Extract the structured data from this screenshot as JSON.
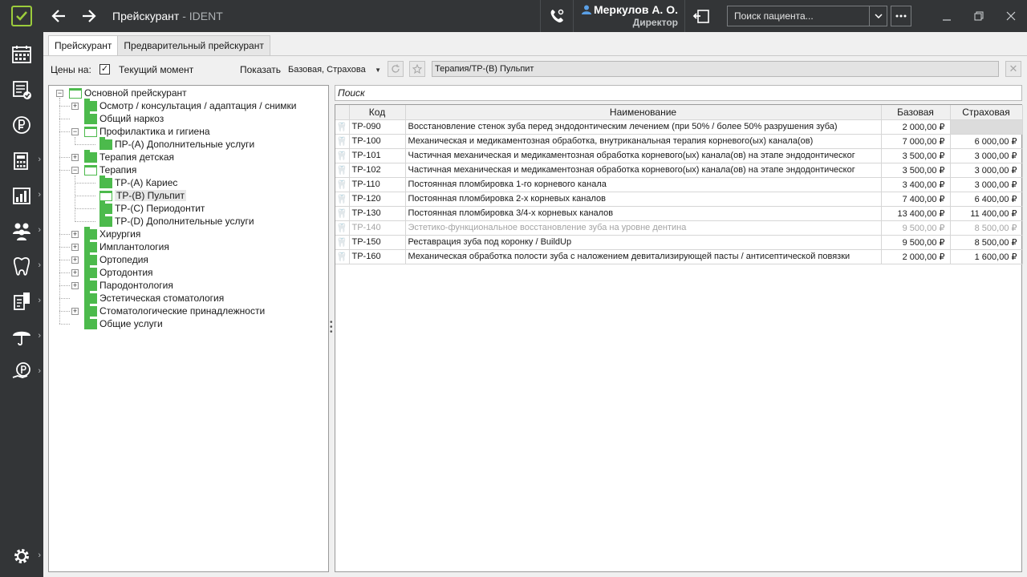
{
  "window": {
    "title": "Прейскурант",
    "app_suffix": "- IDENT"
  },
  "user": {
    "name": "Меркулов А. О.",
    "role": "Директор"
  },
  "search_patient": {
    "placeholder": "Поиск пациента..."
  },
  "icons": {
    "logo": "check-logo-icon",
    "back": "arrow-left-icon",
    "forward": "arrow-right-icon",
    "phone": "phone-settings-icon",
    "user": "user-icon",
    "history": "back-history-icon",
    "more": "ellipsis-icon"
  },
  "sidebar": {
    "items": [
      {
        "icon": "schedule-grid-icon",
        "has_submenu": false
      },
      {
        "icon": "visits-list-icon",
        "has_submenu": false
      },
      {
        "icon": "ruble-icon",
        "has_submenu": false
      },
      {
        "icon": "calculator-icon",
        "has_submenu": true
      },
      {
        "icon": "reports-icon",
        "has_submenu": true
      },
      {
        "icon": "patients-icon",
        "has_submenu": true
      },
      {
        "icon": "tooth-icon",
        "has_submenu": true
      },
      {
        "icon": "documents-icon",
        "has_submenu": true
      },
      {
        "icon": "umbrella-icon",
        "has_submenu": true
      },
      {
        "icon": "ruble-hand-icon",
        "has_submenu": true
      }
    ],
    "settings_icon": "gear-icon"
  },
  "tabs": [
    {
      "label": "Прейскурант",
      "active": true
    },
    {
      "label": "Предварительный прейскурант",
      "active": false
    }
  ],
  "toolbar": {
    "prices_on_label": "Цены на:",
    "current_moment_label": "Текущий момент",
    "current_moment_checked": true,
    "show_label": "Показать",
    "show_value": "Базовая, Страхова",
    "path": "Терапия/ТР-(B) Пульпит",
    "clear_symbol": "✕"
  },
  "tree": {
    "root": "Основной прейскурант",
    "nodes": [
      {
        "label": "Осмотр / консультация / адаптация / снимки",
        "level": 1,
        "expand": "plus",
        "folder": "closed"
      },
      {
        "label": "Общий наркоз",
        "level": 1,
        "expand": "none",
        "folder": "closed"
      },
      {
        "label": "Профилактика и гигиена",
        "level": 1,
        "expand": "minus",
        "folder": "open"
      },
      {
        "label": "ПР-(A) Дополнительные услуги",
        "level": 2,
        "expand": "none",
        "folder": "closed"
      },
      {
        "label": "Терапия детская",
        "level": 1,
        "expand": "plus",
        "folder": "closed"
      },
      {
        "label": "Терапия",
        "level": 1,
        "expand": "minus",
        "folder": "open"
      },
      {
        "label": "ТР-(A) Кариес",
        "level": 2,
        "expand": "none",
        "folder": "closed"
      },
      {
        "label": "ТР-(B) Пульпит",
        "level": 2,
        "expand": "none",
        "folder": "open",
        "selected": true
      },
      {
        "label": "ТР-(C) Периодонтит",
        "level": 2,
        "expand": "none",
        "folder": "closed"
      },
      {
        "label": "ТР-(D) Дополнительные услуги",
        "level": 2,
        "expand": "none",
        "folder": "closed"
      },
      {
        "label": "Хирургия",
        "level": 1,
        "expand": "plus",
        "folder": "closed"
      },
      {
        "label": "Имплантология",
        "level": 1,
        "expand": "plus",
        "folder": "closed"
      },
      {
        "label": "Ортопедия",
        "level": 1,
        "expand": "plus",
        "folder": "closed"
      },
      {
        "label": "Ортодонтия",
        "level": 1,
        "expand": "plus",
        "folder": "closed"
      },
      {
        "label": "Пародонтология",
        "level": 1,
        "expand": "plus",
        "folder": "closed"
      },
      {
        "label": "Эстетическая стоматология",
        "level": 1,
        "expand": "none",
        "folder": "closed"
      },
      {
        "label": "Стоматологические принадлежности",
        "level": 1,
        "expand": "plus",
        "folder": "closed"
      },
      {
        "label": "Общие услуги",
        "level": 1,
        "expand": "none",
        "folder": "closed"
      }
    ]
  },
  "grid": {
    "search_placeholder": "Поиск",
    "columns": [
      "Код",
      "Наименование",
      "Базовая",
      "Страховая"
    ],
    "rows": [
      {
        "code": "ТР-090",
        "name": "Восстановление стенок зуба перед эндодонтическим лечением (при 50% / более 50% разрушения зуба)",
        "base": "2 000,00 ₽",
        "insurance": "",
        "disabled": false
      },
      {
        "code": "ТР-100",
        "name": "Механическая и медикаментозная обработка, внутриканальная терапия корневого(ых) канала(ов)",
        "base": "7 000,00 ₽",
        "insurance": "6 000,00 ₽",
        "disabled": false
      },
      {
        "code": "ТР-101",
        "name": "Частичная механическая и медикаментозная обработка корневого(ых) канала(ов) на этапе эндодонтическог",
        "base": "3 500,00 ₽",
        "insurance": "3 000,00 ₽",
        "disabled": false
      },
      {
        "code": "ТР-102",
        "name": "Частичная механическая и медикаментозная обработка корневого(ых) канала(ов) на этапе эндодонтическог",
        "base": "3 500,00 ₽",
        "insurance": "3 000,00 ₽",
        "disabled": false
      },
      {
        "code": "ТР-110",
        "name": "Постоянная пломбировка 1-го корневого канала",
        "base": "3 400,00 ₽",
        "insurance": "3 000,00 ₽",
        "disabled": false
      },
      {
        "code": "ТР-120",
        "name": "Постоянная пломбировка 2-х корневых каналов",
        "base": "7 400,00 ₽",
        "insurance": "6 400,00 ₽",
        "disabled": false
      },
      {
        "code": "ТР-130",
        "name": "Постоянная пломбировка 3/4-х корневых каналов",
        "base": "13 400,00 ₽",
        "insurance": "11 400,00 ₽",
        "disabled": false
      },
      {
        "code": "ТР-140",
        "name": "Эстетико-функциональное восстановление зуба на уровне дентина",
        "base": "9 500,00 ₽",
        "insurance": "8 500,00 ₽",
        "disabled": true
      },
      {
        "code": "ТР-150",
        "name": "Реставрация зуба под коронку / BuildUp",
        "base": "9 500,00 ₽",
        "insurance": "8 500,00 ₽",
        "disabled": false
      },
      {
        "code": "ТР-160",
        "name": "Механическая обработка полости зуба с наложением девитализирующей пасты / антисептической повязки",
        "base": "2 000,00 ₽",
        "insurance": "1 600,00 ₽",
        "disabled": false
      }
    ]
  },
  "colors": {
    "chrome": "#333537",
    "accent": "#9ccc3c",
    "folder": "#4cba4c"
  }
}
